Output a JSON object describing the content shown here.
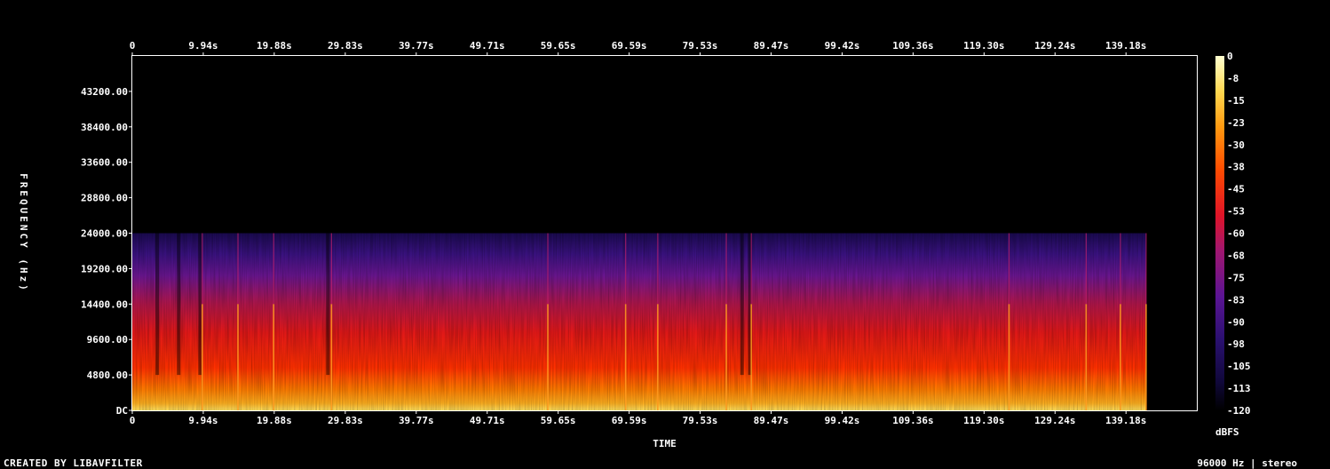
{
  "chart_data": {
    "type": "heatmap",
    "title": "",
    "xlabel": "TIME",
    "ylabel": "FREQUENCY (Hz)",
    "x_ticks": [
      "0",
      "9.94s",
      "19.88s",
      "29.83s",
      "39.77s",
      "49.71s",
      "59.65s",
      "69.59s",
      "79.53s",
      "89.47s",
      "99.42s",
      "109.36s",
      "119.30s",
      "129.24s",
      "139.18s"
    ],
    "x_tick_values": [
      0,
      9.94,
      19.88,
      29.83,
      39.77,
      49.71,
      59.65,
      69.59,
      79.53,
      89.47,
      99.42,
      109.36,
      119.3,
      129.24,
      139.18
    ],
    "xlim": [
      0,
      149.1
    ],
    "y_ticks": [
      "DC",
      "4800.00",
      "9600.00",
      "14400.00",
      "19200.00",
      "24000.00",
      "28800.00",
      "33600.00",
      "38400.00",
      "43200.00"
    ],
    "y_tick_values": [
      0,
      4800,
      9600,
      14400,
      19200,
      24000,
      28800,
      33600,
      38400,
      43200
    ],
    "ylim": [
      0,
      48000
    ],
    "colorbar": {
      "label": "dBFS",
      "ticks": [
        "0",
        "-8",
        "-15",
        "-23",
        "-30",
        "-38",
        "-45",
        "-53",
        "-60",
        "-68",
        "-75",
        "-83",
        "-90",
        "-98",
        "-105",
        "-113",
        "-120"
      ],
      "range": [
        -120,
        0
      ]
    },
    "content_top_hz": 24000,
    "end_time_s": 142.0,
    "bright_transients_s": [
      9.8,
      14.8,
      19.8,
      27.9,
      58.2,
      69.1,
      73.6,
      83.2,
      86.7,
      122.8,
      133.6,
      138.4,
      142.0
    ],
    "quiet_dips_s": [
      3.5,
      6.5,
      9.5,
      27.4,
      85.4,
      86.5
    ],
    "colors": {
      "background": "#000000",
      "frame": "#ffffff",
      "colormap": [
        "#000000",
        "#1a0a4a",
        "#3c1280",
        "#7a1896",
        "#c81440",
        "#ff2000",
        "#ff7000",
        "#ffd040",
        "#ffffc0"
      ]
    }
  },
  "footer": {
    "credit": "CREATED BY LIBAVFILTER",
    "info": "96000 Hz | stereo"
  }
}
